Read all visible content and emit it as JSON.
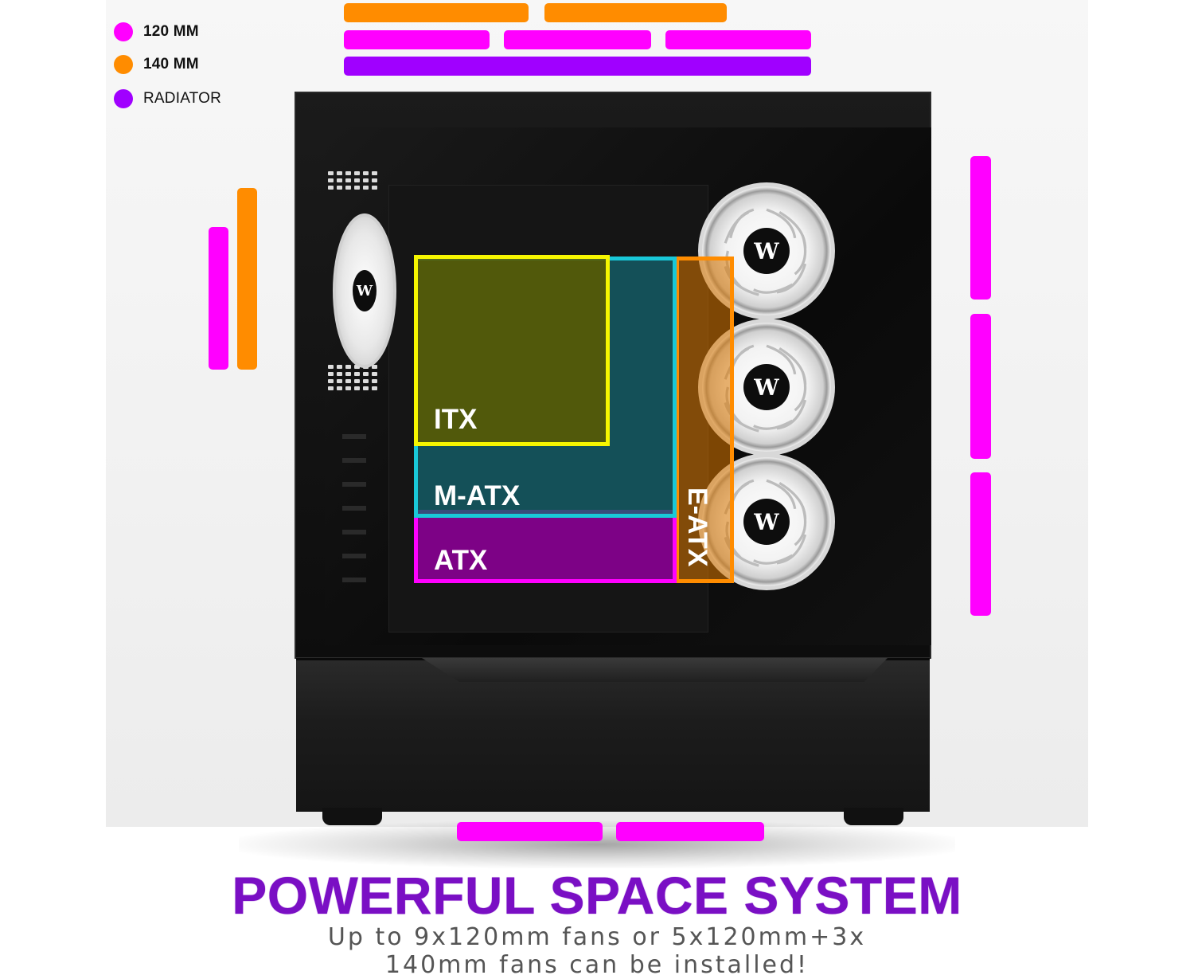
{
  "legend": {
    "items": [
      {
        "label": "120 MM",
        "color": "#ff00ff"
      },
      {
        "label": "140 MM",
        "color": "#ff8c00"
      },
      {
        "label": "RADIATOR",
        "color": "#a000ff"
      }
    ]
  },
  "form_factors": {
    "itx": "ITX",
    "matx": "M-ATX",
    "atx": "ATX",
    "eatx": "E-ATX"
  },
  "fan_logo": "W",
  "headline": "POWERFUL SPACE SYSTEM",
  "subtitle_line1": "Up to 9x120mm fans or 5x120mm+3x",
  "subtitle_line2": "140mm fans can be installed!",
  "colors": {
    "fan_120": "#ff00ff",
    "fan_140": "#ff8c00",
    "radiator": "#a000ff",
    "headline": "#7a0fc4"
  }
}
